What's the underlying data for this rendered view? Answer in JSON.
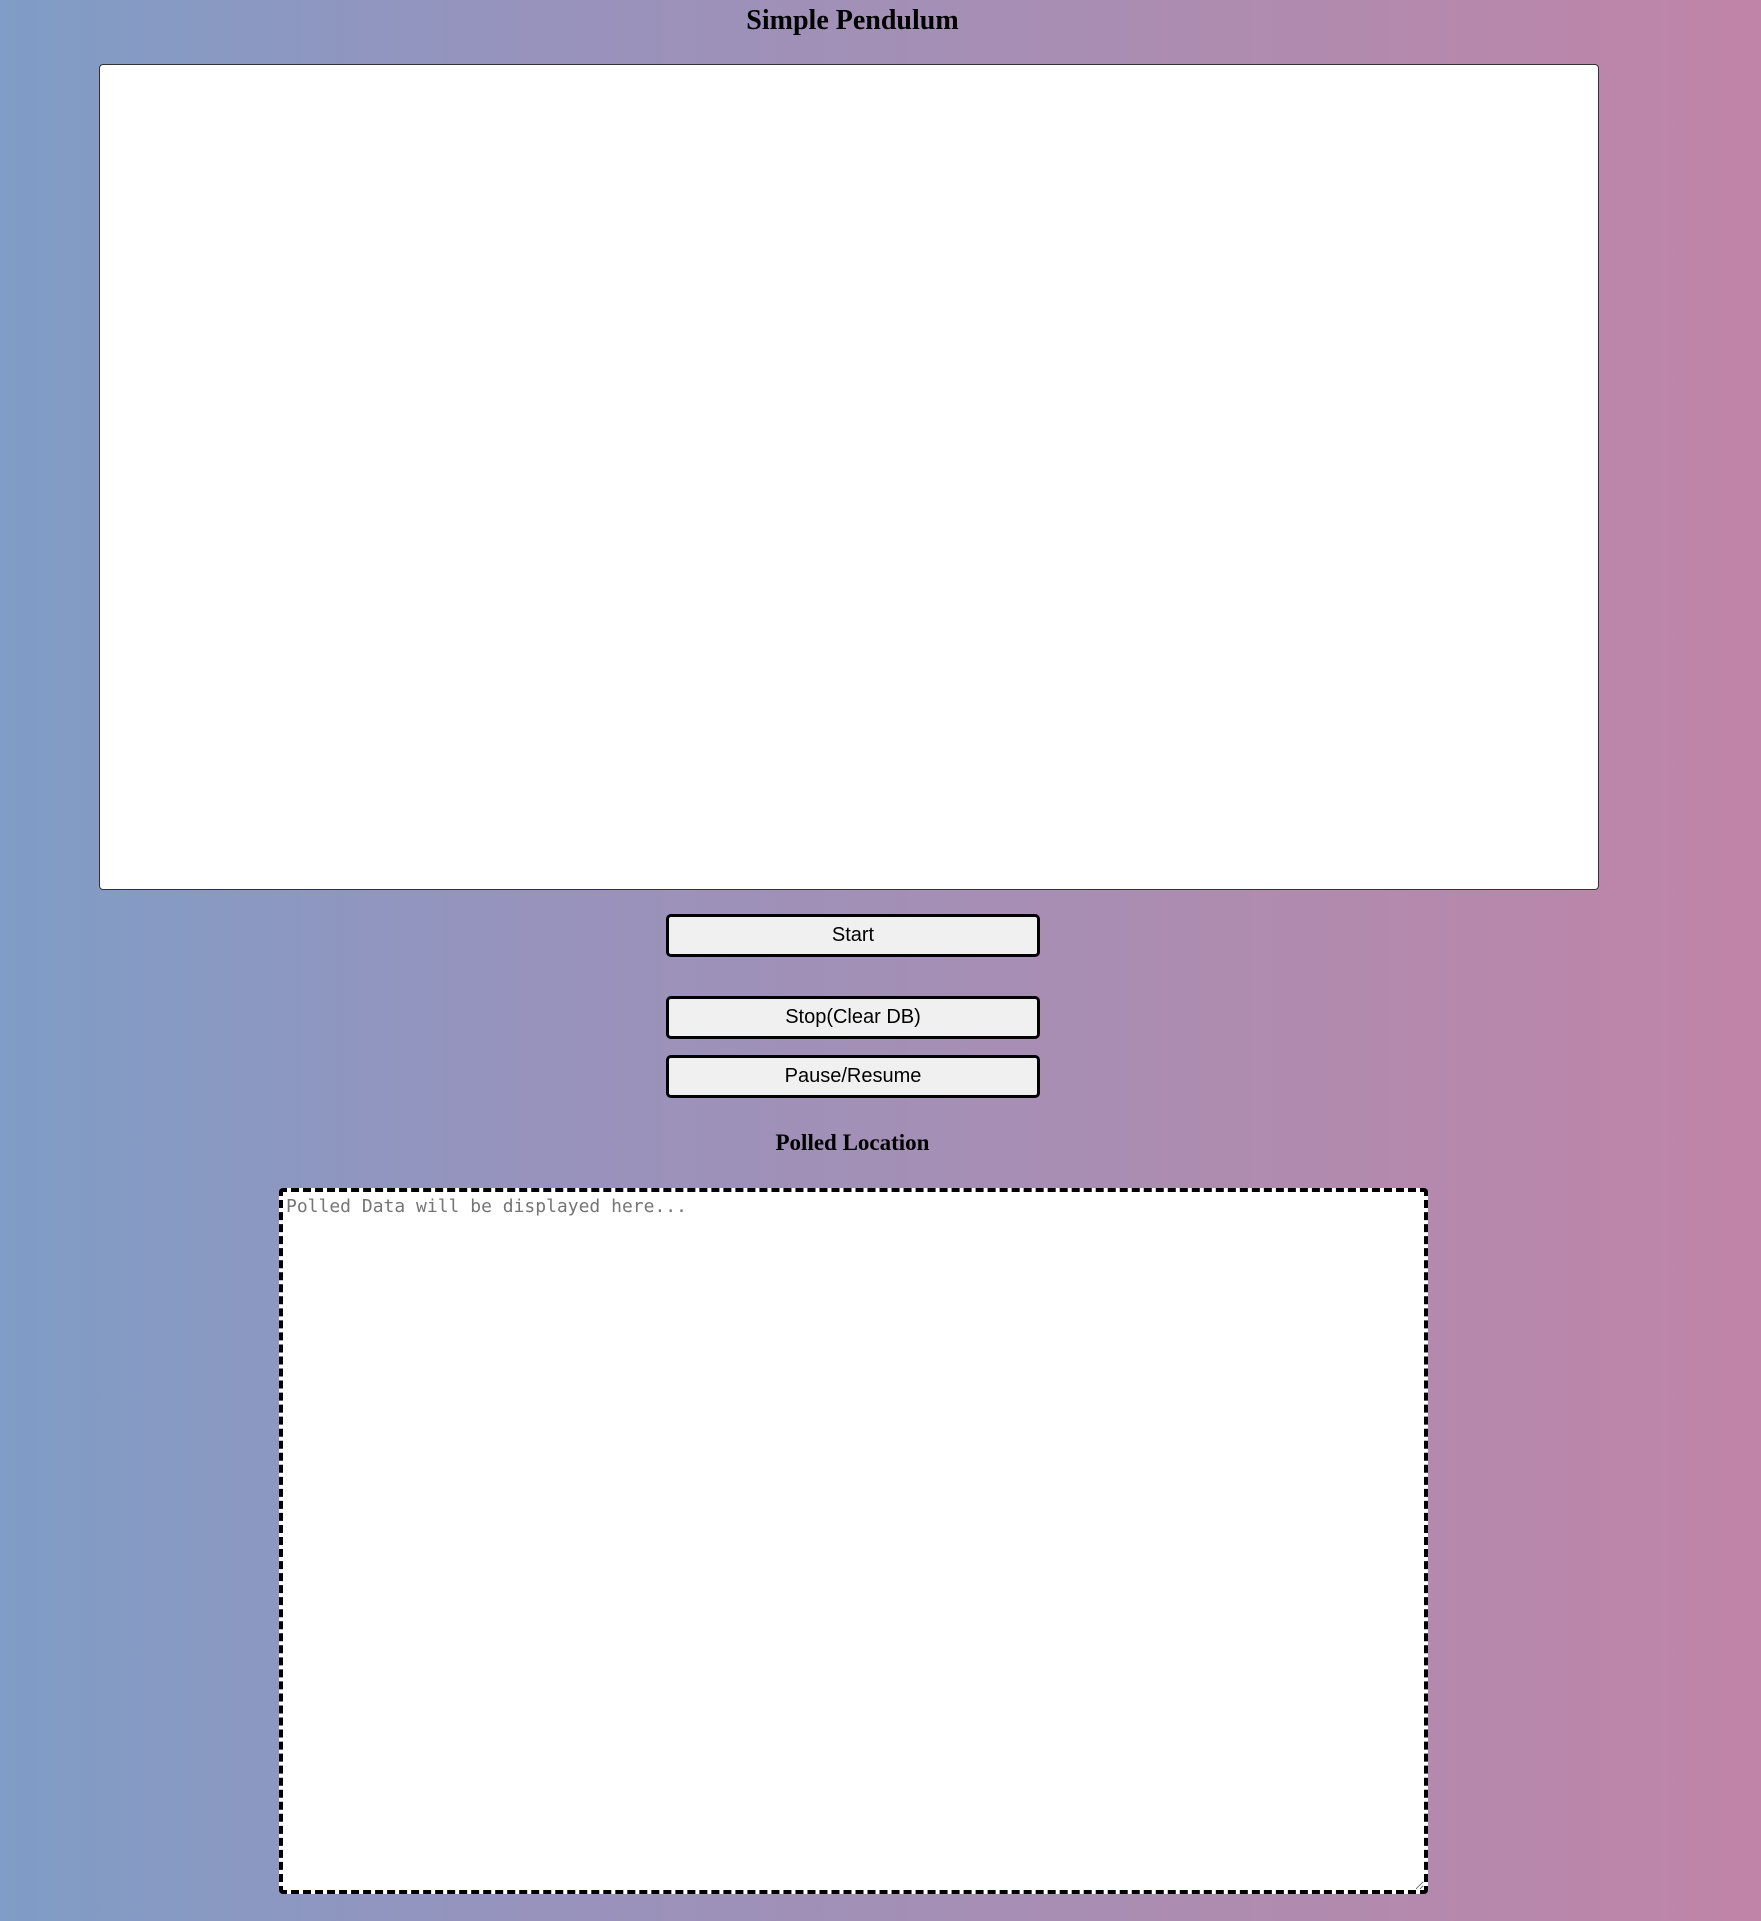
{
  "page": {
    "title": "Simple Pendulum"
  },
  "controls": {
    "start_label": "Start",
    "stop_label": "Stop(Clear DB)",
    "pause_label": "Pause/Resume"
  },
  "polled": {
    "heading": "Polled Location",
    "placeholder": "Polled Data will be displayed here...",
    "value": ""
  },
  "colors": {
    "background_gradient_start": "#7f9dc6",
    "background_gradient_end": "#c084a8",
    "button_fill": "#f0f0f0",
    "panel_fill": "#ffffff"
  }
}
